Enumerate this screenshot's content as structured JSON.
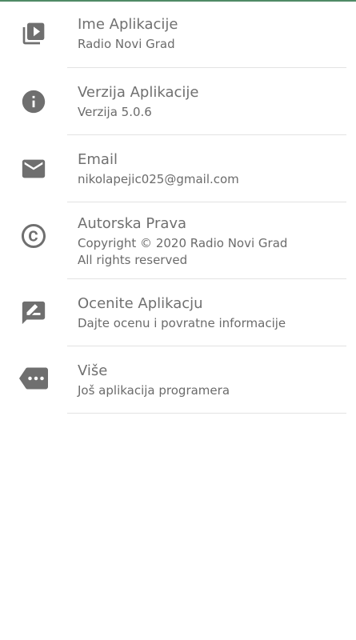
{
  "colors": {
    "accent": "#4f8a66",
    "icon": "#6f6f6f",
    "divider": "#e3e3e3"
  },
  "items": [
    {
      "icon": "video-library-icon",
      "title": "Ime Aplikacije",
      "subtitle": "Radio Novi Grad"
    },
    {
      "icon": "info-icon",
      "title": "Verzija Aplikacije",
      "subtitle": "Verzija 5.0.6"
    },
    {
      "icon": "email-icon",
      "title": "Email",
      "subtitle": "nikolapejic025@gmail.com"
    },
    {
      "icon": "copyright-icon",
      "title": "Autorska Prava",
      "subtitle": "Copyright © 2020 Radio Novi Grad\n All rights reserved"
    },
    {
      "icon": "rate-review-icon",
      "title": "Ocenite Aplikacju",
      "subtitle": "Dajte ocenu i povratne informacije"
    },
    {
      "icon": "more-tag-icon",
      "title": "Više",
      "subtitle": "Još aplikacija programera"
    }
  ]
}
